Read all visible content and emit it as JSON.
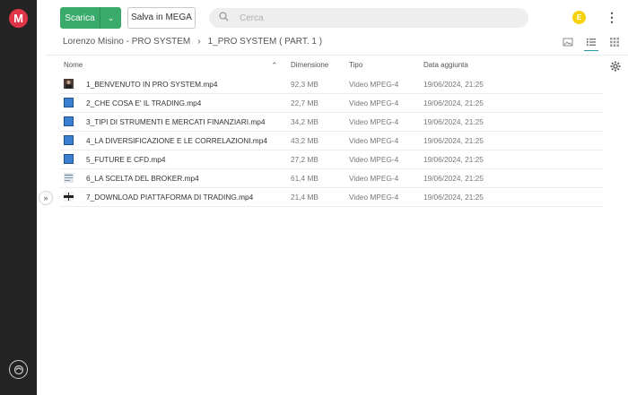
{
  "app": {
    "logo_letter": "M"
  },
  "toolbar": {
    "download_label": "Scarica",
    "save_mega_label": "Salva in MEGA",
    "search_placeholder": "Cerca",
    "avatar_initial": "E"
  },
  "breadcrumb": {
    "parent": "Lorenzo Misino - PRO SYSTEM",
    "current": "1_PRO SYSTEM ( PART. 1 )"
  },
  "columns": {
    "name": "Nome",
    "size": "Dimensione",
    "type": "Tipo",
    "date": "Data aggiunta"
  },
  "files": [
    {
      "name": "1_BENVENUTO IN PRO SYSTEM.mp4",
      "size": "92,3 MB",
      "type": "Video MPEG-4",
      "date": "19/06/2024, 21:25",
      "thumb": "photo"
    },
    {
      "name": "2_CHE COSA E' IL TRADING.mp4",
      "size": "22,7 MB",
      "type": "Video MPEG-4",
      "date": "19/06/2024, 21:25",
      "thumb": "blue"
    },
    {
      "name": "3_TIPI DI STRUMENTI E MERCATI FINANZIARI.mp4",
      "size": "34,2 MB",
      "type": "Video MPEG-4",
      "date": "19/06/2024, 21:25",
      "thumb": "blue"
    },
    {
      "name": "4_LA DIVERSIFICAZIONE E LE CORRELAZIONI.mp4",
      "size": "43,2 MB",
      "type": "Video MPEG-4",
      "date": "19/06/2024, 21:25",
      "thumb": "blue"
    },
    {
      "name": "5_FUTURE E CFD.mp4",
      "size": "27,2 MB",
      "type": "Video MPEG-4",
      "date": "19/06/2024, 21:25",
      "thumb": "blue"
    },
    {
      "name": "6_LA SCELTA DEL BROKER.mp4",
      "size": "61,4 MB",
      "type": "Video MPEG-4",
      "date": "19/06/2024, 21:25",
      "thumb": "doc"
    },
    {
      "name": "7_DOWNLOAD PIATTAFORMA DI TRADING.mp4",
      "size": "21,4 MB",
      "type": "Video MPEG-4",
      "date": "19/06/2024, 21:25",
      "thumb": "dark"
    }
  ],
  "colors": {
    "accent_green": "#3aaa6a",
    "brand_red": "#e03546",
    "rail": "#232323",
    "active_view": "#2a9ca0"
  }
}
